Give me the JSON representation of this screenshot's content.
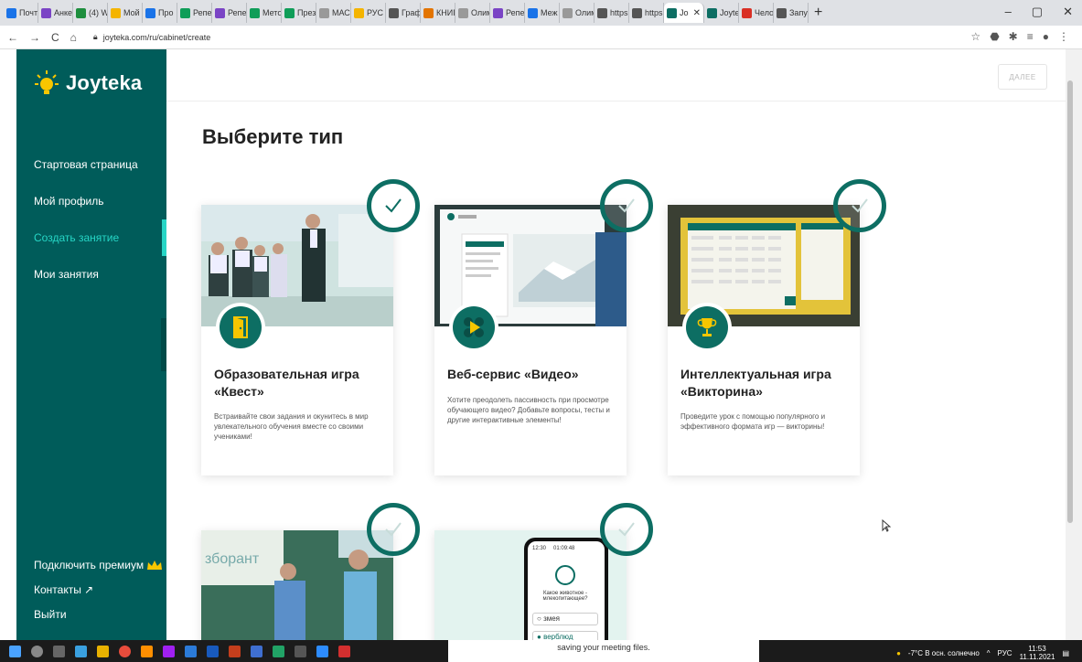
{
  "browser": {
    "tabs": [
      {
        "label": "Почт",
        "color": "#1a73e8"
      },
      {
        "label": "Анкет",
        "color": "#7a44c5"
      },
      {
        "label": "(4) W",
        "color": "#1e8e3e"
      },
      {
        "label": "Мой",
        "color": "#f4b400"
      },
      {
        "label": "Про",
        "color": "#1a73e8"
      },
      {
        "label": "Репе",
        "color": "#0f9d58"
      },
      {
        "label": "Репе",
        "color": "#7a44c5"
      },
      {
        "label": "Мето",
        "color": "#0f9d58"
      },
      {
        "label": "През",
        "color": "#0f9d58"
      },
      {
        "label": "МАС",
        "color": "#999999"
      },
      {
        "label": "РУС",
        "color": "#f4b400"
      },
      {
        "label": "Граф",
        "color": "#555555"
      },
      {
        "label": "КНИГ",
        "color": "#e37400"
      },
      {
        "label": "Олим",
        "color": "#999999"
      },
      {
        "label": "Репе",
        "color": "#7a44c5"
      },
      {
        "label": "Меж",
        "color": "#1a73e8"
      },
      {
        "label": "Олим",
        "color": "#999999"
      },
      {
        "label": "https",
        "color": "#555555"
      },
      {
        "label": "https",
        "color": "#555555"
      },
      {
        "label": "Jo",
        "color": "#0d6e63",
        "active": true
      },
      {
        "label": "Joyte",
        "color": "#0d6e63"
      },
      {
        "label": "Чело",
        "color": "#d93025"
      },
      {
        "label": "Запу",
        "color": "#555555"
      }
    ],
    "url": "joyteka.com/ru/cabinet/create",
    "new_tab": "+",
    "controls": {
      "minimize": "–",
      "maximize": "▢",
      "close": "✕"
    }
  },
  "sidebar": {
    "logo": "Joyteka",
    "items": [
      {
        "label": "Стартовая страница"
      },
      {
        "label": "Мой профиль"
      },
      {
        "label": "Создать занятие",
        "active": true
      },
      {
        "label": "Мои занятия"
      }
    ],
    "bottom": {
      "premium": "Подключить премиум",
      "contacts": "Контакты ↗",
      "logout": "Выйти"
    },
    "collapse": "‹"
  },
  "main": {
    "next_button": "ДАЛЕЕ",
    "title": "Выберите тип",
    "cards": [
      {
        "title": "Образовательная игра «Квест»",
        "desc": "Встраивайте свои задания и окунитесь в мир увлекательного обучения вместе со своими учениками!",
        "icon": "door-icon",
        "selected": true
      },
      {
        "title": "Веб-сервис «Видео»",
        "desc": "Хотите преодолеть пассивность при просмотре обучающего видео? Добавьте вопросы, тесты и другие интерактивные элементы!",
        "icon": "play-icon",
        "selected": false
      },
      {
        "title": "Интеллектуальная игра «Викторина»",
        "desc": "Проведите урок с помощью популярного и эффективного формата игр — викторины!",
        "icon": "trophy-icon",
        "selected": false
      }
    ],
    "phone": {
      "time1": "12:30",
      "time2": "01:09:48",
      "question": "Какое животное - млекопитающее?",
      "opt1": "змея",
      "opt2": "верблюд"
    },
    "poster_text": "зборант"
  },
  "taskbar": {
    "meeting": "saving your meeting files.",
    "weather": "-7°C В осн. солнечно",
    "lang": "РУС",
    "time": "11:53",
    "date": "11.11.2021"
  },
  "colors": {
    "sidebar": "#005c5a",
    "accent": "#26d6c6",
    "check": "#0d6e63"
  }
}
